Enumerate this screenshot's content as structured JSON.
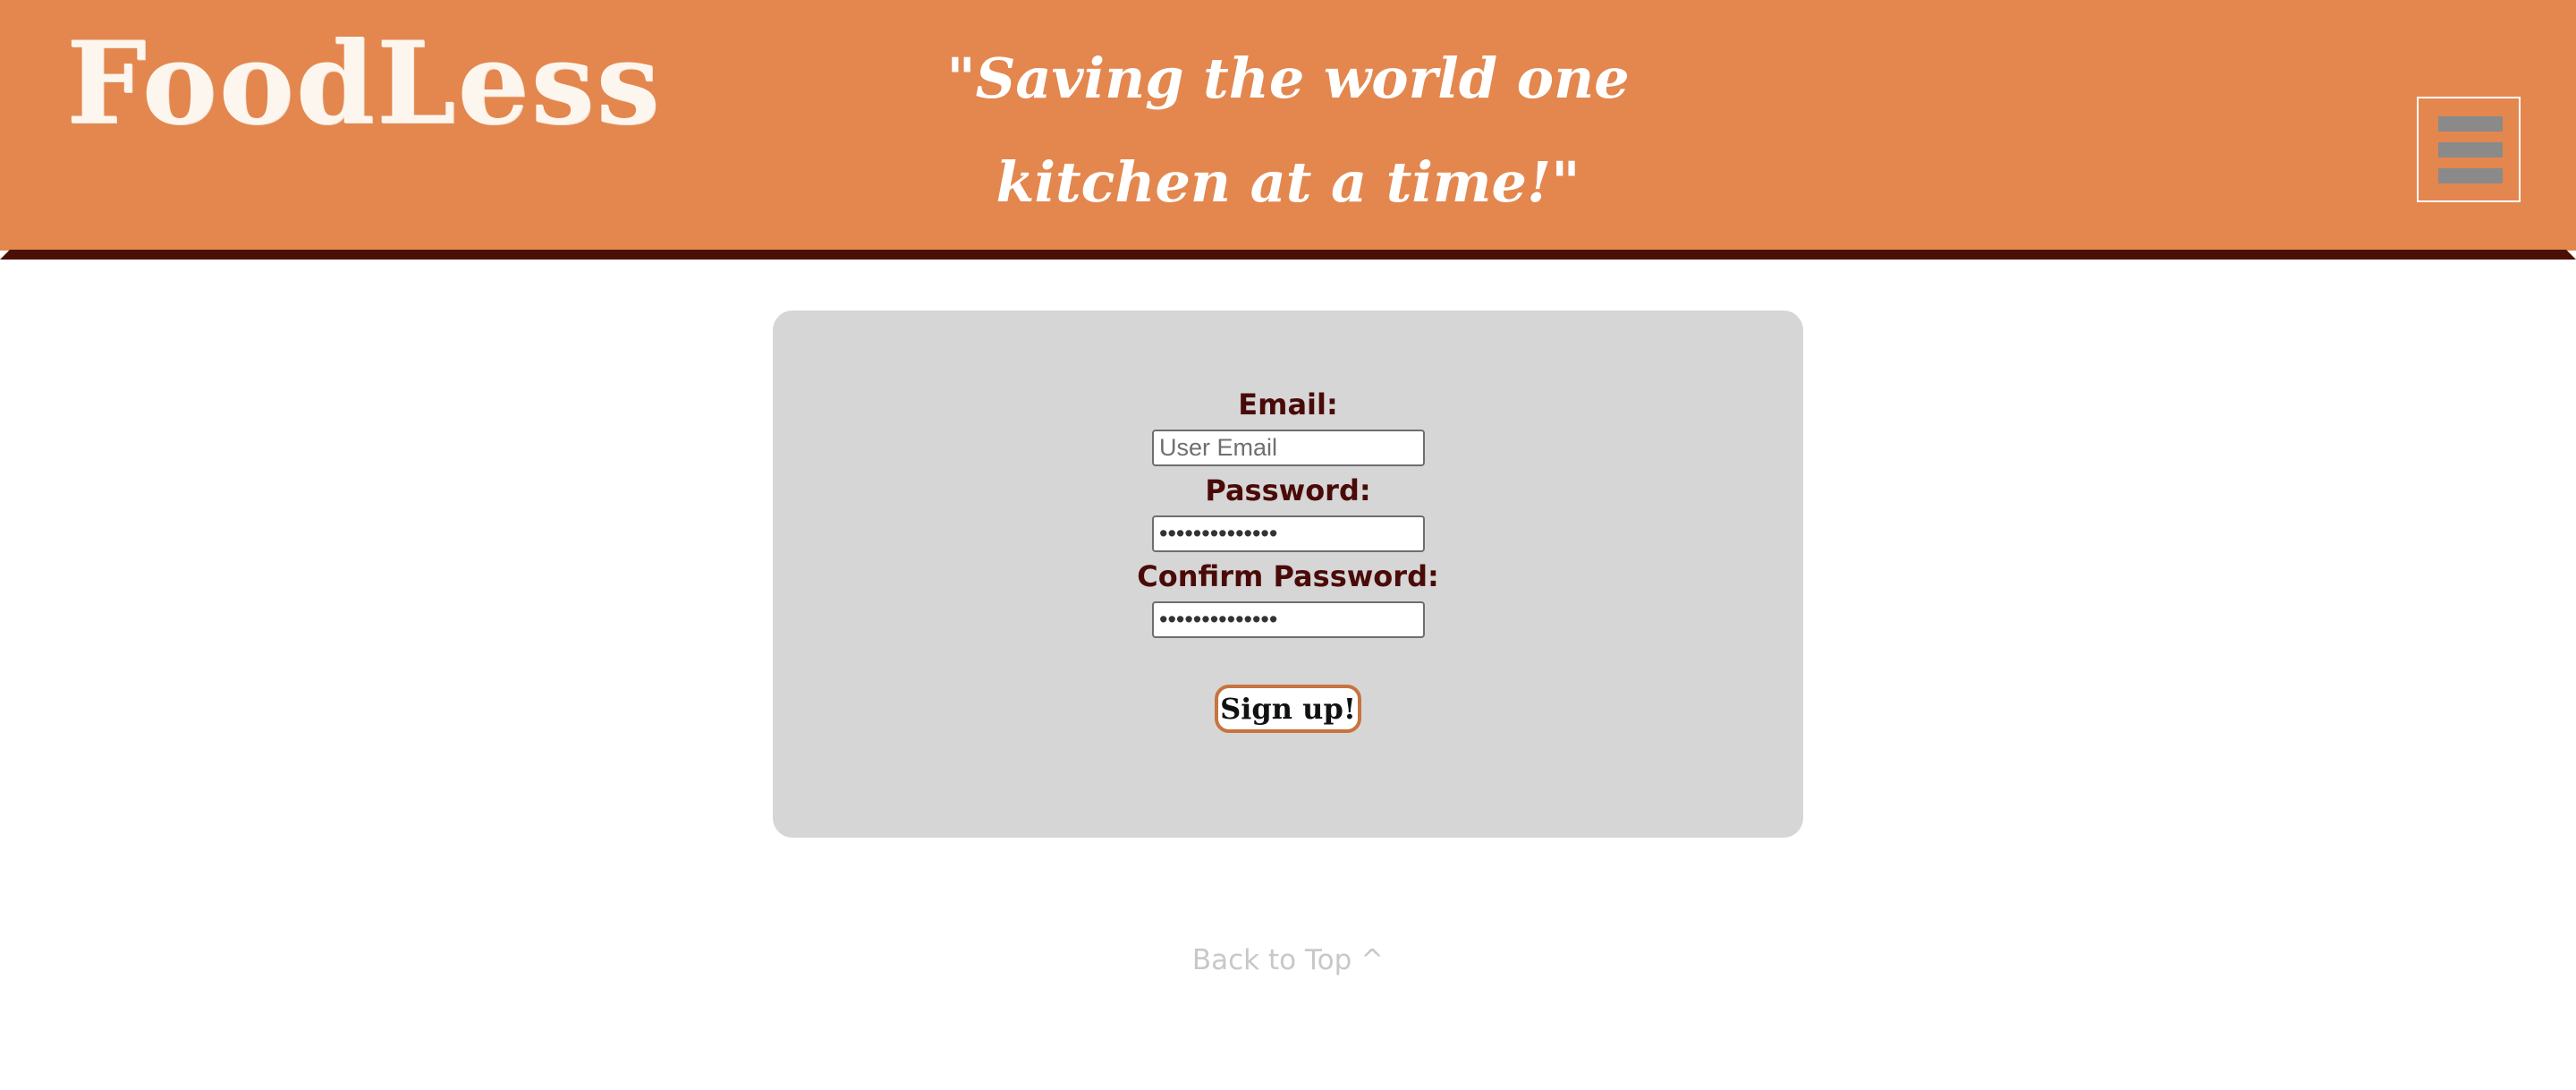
{
  "header": {
    "logo": "FoodLess",
    "tagline": "\"Saving the world one kitchen at a time!\"",
    "menu_icon": "hamburger-menu-icon"
  },
  "signup_form": {
    "email_label": "Email:",
    "email_placeholder": "User Email",
    "email_value": "",
    "password_label": "Password:",
    "password_value": "••••••••••••••",
    "confirm_password_label": "Confirm Password:",
    "confirm_password_value": "••••••••••••••",
    "submit_label": "Sign up!"
  },
  "footer": {
    "back_to_top": "Back to Top ^"
  },
  "colors": {
    "header_bg": "#e3874f",
    "header_border": "#4a1006",
    "label_text": "#4a0b08",
    "card_bg": "#d6d6d6",
    "button_border": "#c7743e",
    "link_text": "#c8c8c8"
  }
}
